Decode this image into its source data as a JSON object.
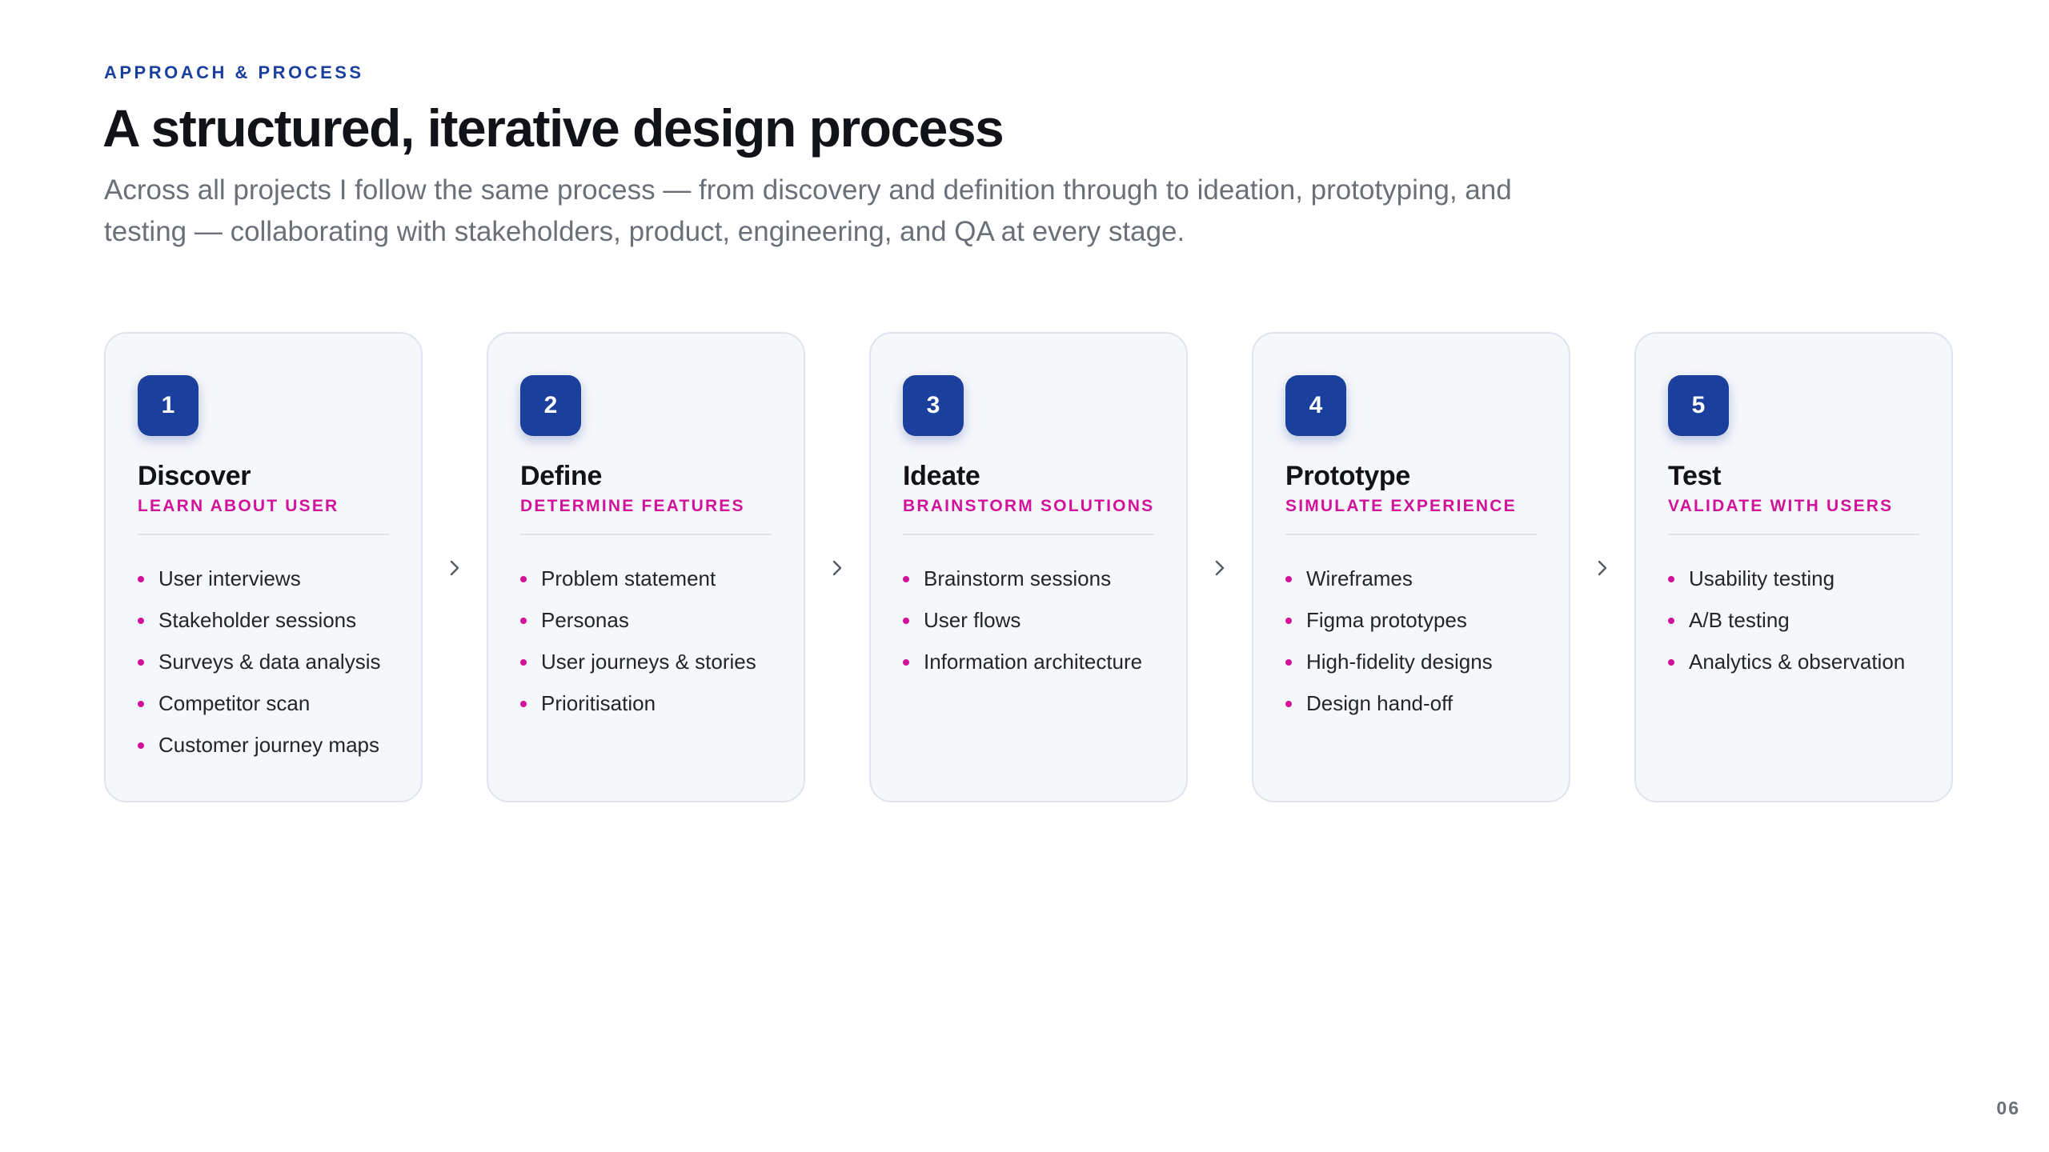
{
  "header": {
    "eyebrow": "APPROACH & PROCESS",
    "title": "A structured, iterative design process",
    "subtitle": "Across all projects I follow the same process — from discovery and definition through to ideation, prototyping, and testing — collaborating with stakeholders, product, engineering, and QA at every stage."
  },
  "colors": {
    "accent_blue": "#1a3f9c",
    "accent_magenta": "#d0139a",
    "card_background": "#f6f7fb"
  },
  "arrow_icon": "chevron-right-icon",
  "steps": [
    {
      "number": "1",
      "title": "Discover",
      "subtitle": "LEARN ABOUT USER",
      "items": [
        "User interviews",
        "Stakeholder sessions",
        "Surveys & data analysis",
        "Competitor scan",
        "Customer journey maps"
      ]
    },
    {
      "number": "2",
      "title": "Define",
      "subtitle": "DETERMINE FEATURES",
      "items": [
        "Problem statement",
        "Personas",
        "User journeys & stories",
        "Prioritisation"
      ]
    },
    {
      "number": "3",
      "title": "Ideate",
      "subtitle": "BRAINSTORM SOLUTIONS",
      "items": [
        "Brainstorm sessions",
        "User flows",
        "Information architecture"
      ]
    },
    {
      "number": "4",
      "title": "Prototype",
      "subtitle": "SIMULATE EXPERIENCE",
      "items": [
        "Wireframes",
        "Figma prototypes",
        "High-fidelity designs",
        "Design hand-off"
      ]
    },
    {
      "number": "5",
      "title": "Test",
      "subtitle": "VALIDATE WITH USERS",
      "items": [
        "Usability testing",
        "A/B testing",
        "Analytics & observation"
      ]
    }
  ],
  "footer": {
    "page_number": "06"
  }
}
